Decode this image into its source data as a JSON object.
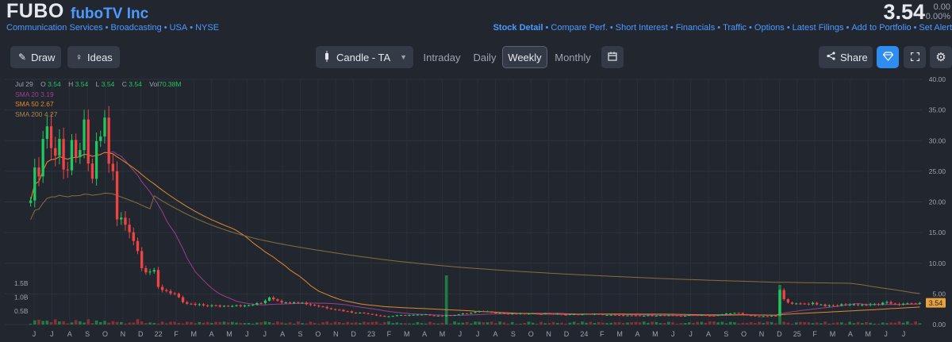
{
  "header": {
    "ticker": "FUBO",
    "company": "fuboTV Inc",
    "breadcrumbs": [
      "Communication Services",
      "Broadcasting",
      "USA",
      "NYSE"
    ],
    "price": "3.54",
    "change_abs": "0.00",
    "change_pct": "0.00%",
    "links": [
      "Stock Detail",
      "Compare Perf.",
      "Short Interest",
      "Financials",
      "Traffic",
      "Options",
      "Latest Filings",
      "Add to Portfolio",
      "Set Alert"
    ]
  },
  "toolbar": {
    "draw_label": "Draw",
    "ideas_label": "Ideas",
    "chart_type": "Candle - TA",
    "intervals": [
      "Intraday",
      "Daily",
      "Weekly",
      "Monthly"
    ],
    "active_interval": "Weekly",
    "share_label": "Share"
  },
  "legend": {
    "date": "Jul 29",
    "open_k": "O",
    "open": "3.54",
    "high_k": "H",
    "high": "3.54",
    "low_k": "L",
    "low": "3.54",
    "close_k": "C",
    "close": "3.54",
    "vol_k": "Vol",
    "vol": "70.38M",
    "sma20_label": "SMA 20",
    "sma20": "3.19",
    "sma50_label": "SMA 50",
    "sma50": "2.67",
    "sma200_label": "SMA 200",
    "sma200": "4.27"
  },
  "colors": {
    "up": "#22c55e",
    "down": "#ef4444",
    "sma20": "#9a3f8f",
    "sma50": "#e08a2e",
    "sma200": "#8a6e3c",
    "accent": "#4c9aff"
  },
  "chart_data": {
    "type": "candlestick",
    "interval": "weekly",
    "y_ticks": [
      "40.00",
      "35.00",
      "30.00",
      "25.00",
      "20.00",
      "15.00",
      "10.00",
      "5.00",
      "0.00"
    ],
    "ylim": [
      0,
      40
    ],
    "volume_ticks": [
      "1.5B",
      "1.0B",
      "0.5B"
    ],
    "x_ticks": [
      "J",
      "J",
      "A",
      "S",
      "O",
      "N",
      "D",
      "22",
      "F",
      "M",
      "A",
      "M",
      "J",
      "J",
      "A",
      "S",
      "O",
      "N",
      "D",
      "23",
      "F",
      "M",
      "A",
      "M",
      "J",
      "J",
      "A",
      "S",
      "O",
      "N",
      "D",
      "24",
      "F",
      "M",
      "A",
      "M",
      "J",
      "J",
      "A",
      "S",
      "O",
      "N",
      "D",
      "25",
      "F",
      "M",
      "A",
      "M",
      "J",
      "J"
    ],
    "last_price_label": "3.54",
    "price_anchors": [
      [
        0,
        22
      ],
      [
        2,
        26
      ],
      [
        3,
        30
      ],
      [
        4,
        33
      ],
      [
        5,
        29
      ],
      [
        6,
        27
      ],
      [
        7,
        32
      ],
      [
        8,
        26
      ],
      [
        9,
        25
      ],
      [
        10,
        28
      ],
      [
        11,
        26
      ],
      [
        12,
        30
      ],
      [
        13,
        31
      ],
      [
        14,
        25
      ],
      [
        15,
        24
      ],
      [
        16,
        28
      ],
      [
        17,
        31
      ],
      [
        18,
        33
      ],
      [
        19,
        27
      ],
      [
        20,
        24
      ],
      [
        21,
        17
      ],
      [
        22,
        17
      ],
      [
        24,
        16
      ],
      [
        26,
        12
      ],
      [
        27,
        10
      ],
      [
        28,
        9
      ],
      [
        30,
        8.5
      ],
      [
        31,
        6
      ],
      [
        33,
        5.5
      ],
      [
        35,
        5
      ],
      [
        37,
        3.5
      ],
      [
        40,
        3.2
      ],
      [
        46,
        3
      ],
      [
        50,
        3.2
      ],
      [
        52,
        3
      ],
      [
        56,
        3.5
      ],
      [
        58,
        4.5
      ],
      [
        62,
        3.5
      ],
      [
        64,
        3.8
      ],
      [
        70,
        3
      ],
      [
        74,
        2.5
      ],
      [
        78,
        2
      ],
      [
        82,
        1.8
      ],
      [
        86,
        1.3
      ],
      [
        90,
        1.5
      ],
      [
        96,
        1.6
      ],
      [
        100,
        1.4
      ],
      [
        106,
        1.8
      ],
      [
        110,
        2.2
      ],
      [
        116,
        1.7
      ],
      [
        126,
        1.8
      ],
      [
        130,
        1.6
      ],
      [
        136,
        1.7
      ],
      [
        142,
        1.5
      ],
      [
        148,
        1.4
      ],
      [
        152,
        1.5
      ],
      [
        158,
        1.4
      ],
      [
        162,
        1.6
      ],
      [
        166,
        1.4
      ],
      [
        170,
        1.9
      ],
      [
        172,
        1.8
      ],
      [
        174,
        1.5
      ],
      [
        178,
        1.3
      ],
      [
        181,
        1.4
      ],
      [
        182,
        5.5
      ],
      [
        183,
        4
      ],
      [
        186,
        3.3
      ],
      [
        190,
        3.5
      ],
      [
        194,
        3
      ],
      [
        198,
        3.3
      ],
      [
        204,
        3.2
      ],
      [
        208,
        3.5
      ],
      [
        212,
        3.3
      ],
      [
        216,
        3.54
      ]
    ]
  }
}
